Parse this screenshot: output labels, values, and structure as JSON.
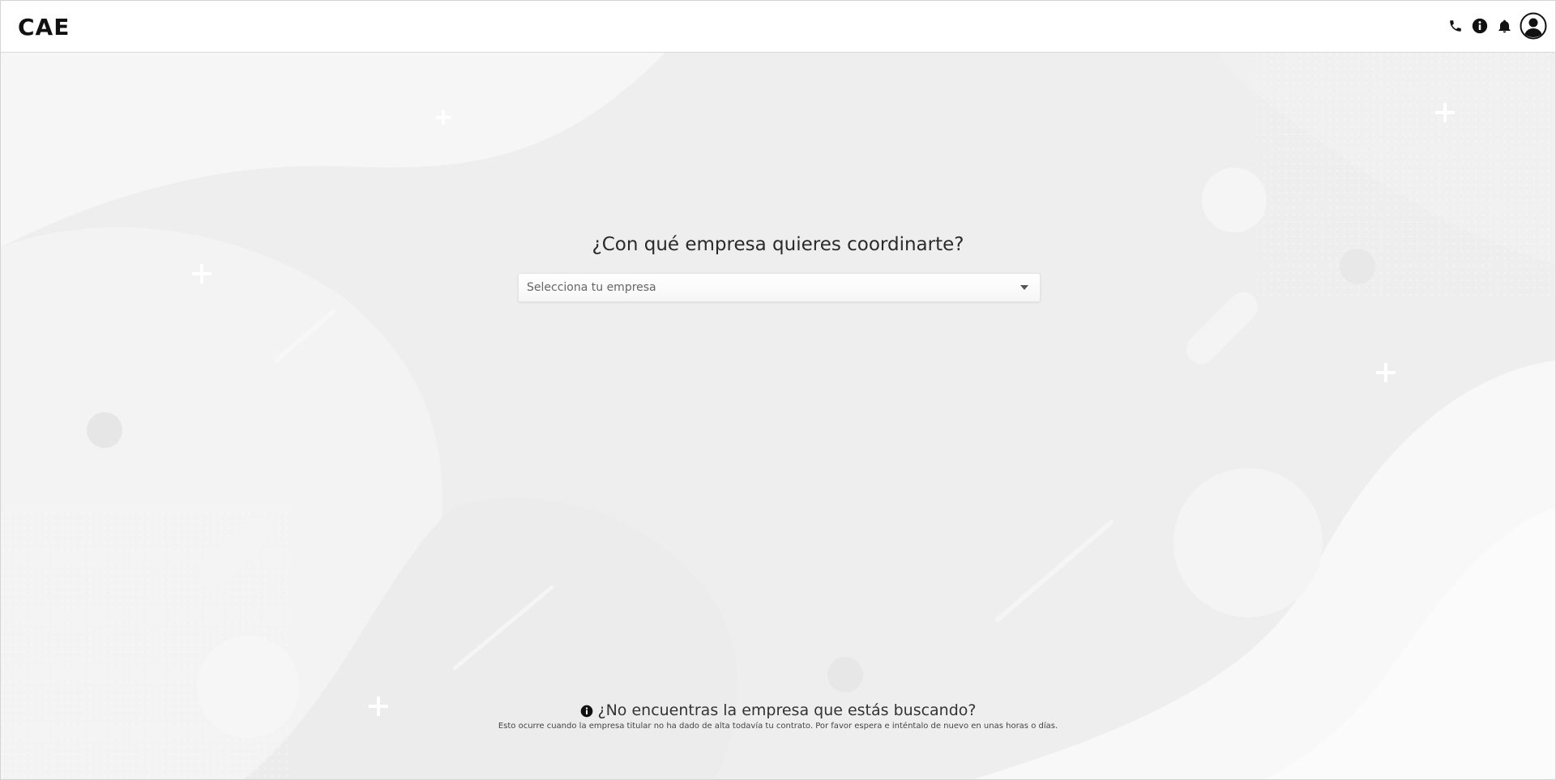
{
  "header": {
    "logo": "CAE",
    "icons": [
      "phone-icon",
      "info-icon",
      "bell-icon",
      "user-avatar-icon"
    ]
  },
  "main": {
    "question": "¿Con qué empresa quieres coordinarte?",
    "company_select": {
      "placeholder": "Selecciona tu empresa"
    },
    "not_found": {
      "title": "¿No encuentras la empresa que estás buscando?",
      "description": "Esto ocurre cuando la empresa titular no ha dado de alta todavía tu contrato. Por favor espera e inténtalo de nuevo en unas horas o días."
    }
  },
  "colors": {
    "header_bg": "#ffffff",
    "page_bg": "#efefef",
    "text": "#222222"
  }
}
